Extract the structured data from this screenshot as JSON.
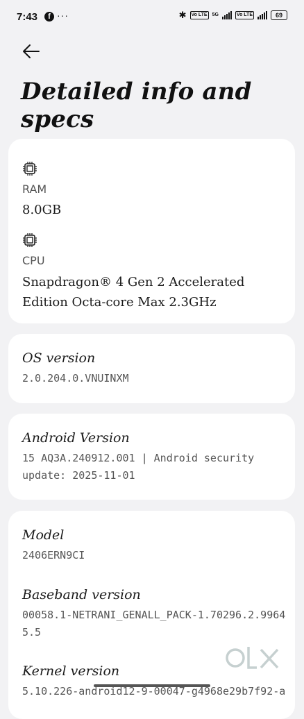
{
  "status_bar": {
    "time": "7:43",
    "facebook_glyph": "f",
    "more": "···",
    "bluetooth": "✱",
    "chip1": "Vo LTE",
    "net": "5G",
    "chip2": "Vo LTE",
    "battery": "69"
  },
  "header": {
    "title": "Detailed info and specs"
  },
  "card_memory_cpu": {
    "ram_label": "RAM",
    "ram_value": "8.0GB",
    "cpu_label": "CPU",
    "cpu_value": "Snapdragon® 4 Gen 2 Accelerated Edition Octa-core Max 2.3GHz"
  },
  "os": {
    "title": "OS version",
    "value": "2.0.204.0.VNUINXM"
  },
  "android": {
    "title": "Android Version",
    "value": "15 AQ3A.240912.001 | Android security update: 2025-11-01"
  },
  "device": {
    "model_title": "Model",
    "model_value": "2406ERN9CI",
    "baseband_title": "Baseband version",
    "baseband_value": "00058.1-NETRANI_GENALL_PACK-1.70296.2.99645.5",
    "kernel_title": "Kernel version",
    "kernel_value": "5.10.226-android12-9-00047-g4968e29b7f92-a"
  },
  "watermark": {
    "text": "OLX"
  },
  "icons": {
    "back": "arrow-left-icon",
    "memory": "chip-icon",
    "cpu": "cpu-chip-icon",
    "facebook": "facebook-icon",
    "bluetooth": "bluetooth-icon",
    "battery": "battery-icon"
  }
}
